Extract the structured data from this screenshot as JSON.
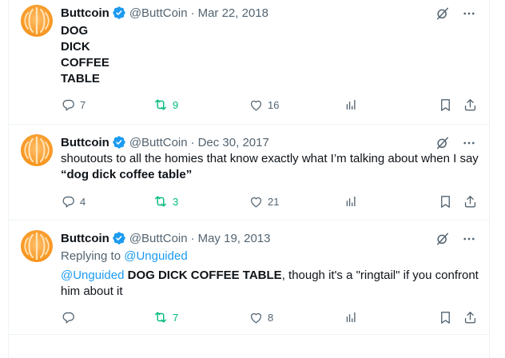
{
  "tweets": [
    {
      "name": "Buttcoin",
      "handle": "@ButtCoin",
      "separator": "·",
      "date": "Mar 22, 2018",
      "lines": [
        "DOG",
        "DICK",
        "COFFEE",
        "TABLE"
      ],
      "replies": "7",
      "retweets": "9",
      "likes": "16"
    },
    {
      "name": "Buttcoin",
      "handle": "@ButtCoin",
      "separator": "·",
      "date": "Dec 30, 2017",
      "text_1": "shoutouts to all the homies that know exactly what I’m talking about when I say ",
      "text_bold": "“dog dick coffee table”",
      "replies": "4",
      "retweets": "3",
      "likes": "21"
    },
    {
      "name": "Buttcoin",
      "handle": "@ButtCoin",
      "separator": "·",
      "date": "May 19, 2013",
      "replying_label": "Replying to ",
      "replying_to": "@Unguided",
      "mention": "@Unguided",
      "text_bold": "DOG DICK COFFEE TABLE",
      "text_rest": ", though it's a \"ringtail\" if you confront him about it",
      "replies": "",
      "retweets": "7",
      "likes": "8"
    }
  ],
  "colors": {
    "text": "#0f1419",
    "muted": "#536471",
    "link": "#1d9bf0",
    "retweet_active": "#00ba7c",
    "verified": "#1d9bf0",
    "avatar": "#f7941d",
    "border": "#eff3f4"
  },
  "icons": [
    "verified-badge-icon",
    "grok-icon",
    "more-icon",
    "reply-icon",
    "retweet-icon",
    "like-icon",
    "views-icon",
    "bookmark-icon",
    "share-icon"
  ]
}
